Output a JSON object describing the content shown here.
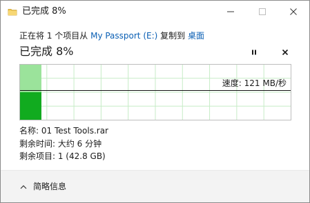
{
  "window": {
    "title": "已完成 8%"
  },
  "copy_info": {
    "prefix": "正在将 1 个项目从 ",
    "source": "My Passport (E:)",
    "middle": " 复制到 ",
    "destination": "桌面"
  },
  "progress": {
    "heading": "已完成 8%",
    "percent": 8,
    "speed_label": "速度: 121 MB/秒"
  },
  "details": {
    "name": "名称: 01 Test Tools.rar",
    "time_remaining": "剩余时间: 大约 6 分钟",
    "items_remaining": "剩余项目: 1 (42.8 GB)"
  },
  "footer": {
    "toggle_label": "简略信息"
  },
  "colors": {
    "link": "#0a5fb4",
    "graph_fill_light": "#9be39b",
    "graph_fill_dark": "#11ab1f",
    "graph_grid": "#c6ecc6",
    "footer_bg": "#f3f3f3"
  },
  "icons": {
    "app": "copy-folder-icon",
    "minimize": "minimize-icon",
    "maximize": "maximize-icon",
    "close": "close-icon",
    "pause": "pause-icon",
    "stop": "stop-icon",
    "toggle": "chevron-up-icon"
  }
}
